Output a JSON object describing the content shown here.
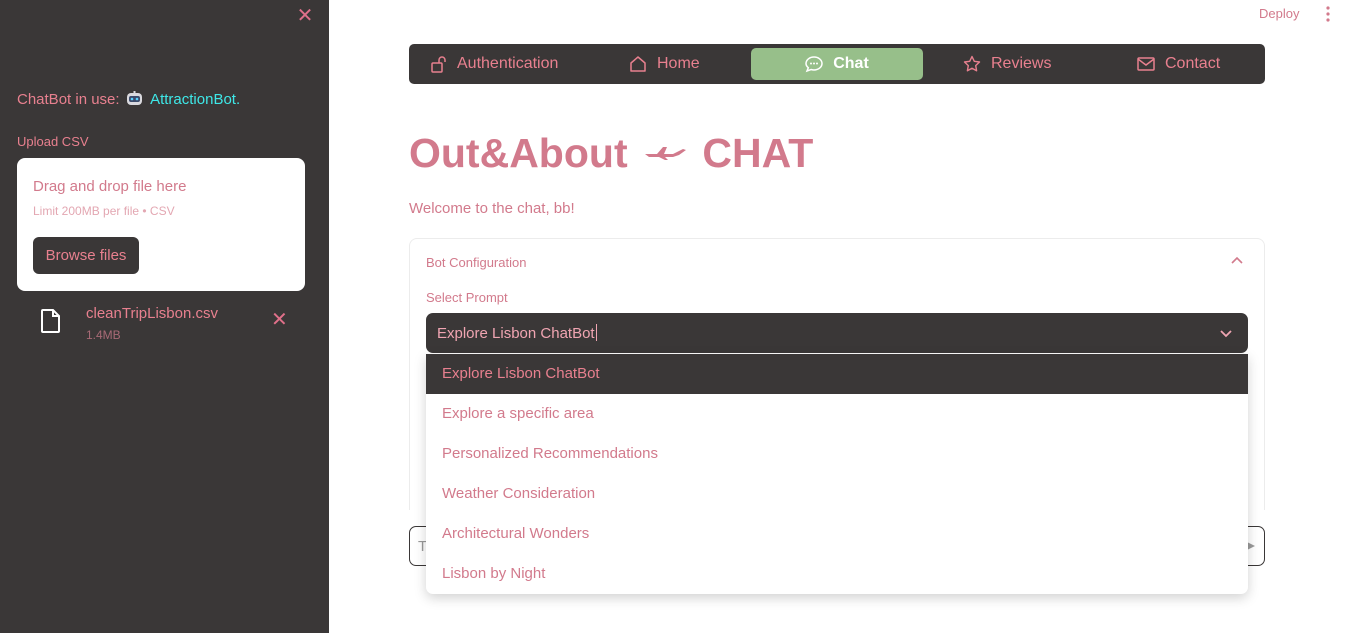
{
  "sidebar": {
    "chatbot_prefix": "ChatBot in use:",
    "chatbot_name": "AttractionBot.",
    "upload_label": "Upload CSV",
    "dropzone_title": "Drag and drop file here",
    "dropzone_limit": "Limit 200MB per file • CSV",
    "browse_label": "Browse files",
    "file": {
      "name": "cleanTripLisbon.csv",
      "size": "1.4MB"
    }
  },
  "header": {
    "deploy_label": "Deploy"
  },
  "nav": {
    "items": [
      {
        "label": "Authentication",
        "icon": "unlock-icon"
      },
      {
        "label": "Home",
        "icon": "home-icon"
      },
      {
        "label": "Chat",
        "icon": "chat-bubble-icon"
      },
      {
        "label": "Reviews",
        "icon": "star-icon"
      },
      {
        "label": "Contact",
        "icon": "envelope-icon"
      }
    ],
    "active_index": 2
  },
  "main": {
    "title_left": "Out&About",
    "title_right": "CHAT",
    "welcome": "Welcome to the chat, bb!"
  },
  "config": {
    "expander_title": "Bot Configuration",
    "select_label": "Select Prompt",
    "selected_value": "Explore Lisbon ChatBot",
    "options": [
      "Explore Lisbon ChatBot",
      "Explore a specific area",
      "Personalized Recommendations",
      "Weather Consideration",
      "Architectural Wonders",
      "Lisbon by Night"
    ]
  },
  "chat_input": {
    "placeholder_visible": "T"
  },
  "colors": {
    "sidebar_bg": "#3a3737",
    "accent_pink": "#d27a8c",
    "active_green": "#97bf8a",
    "bot_name_cyan": "#3ee8e8"
  }
}
